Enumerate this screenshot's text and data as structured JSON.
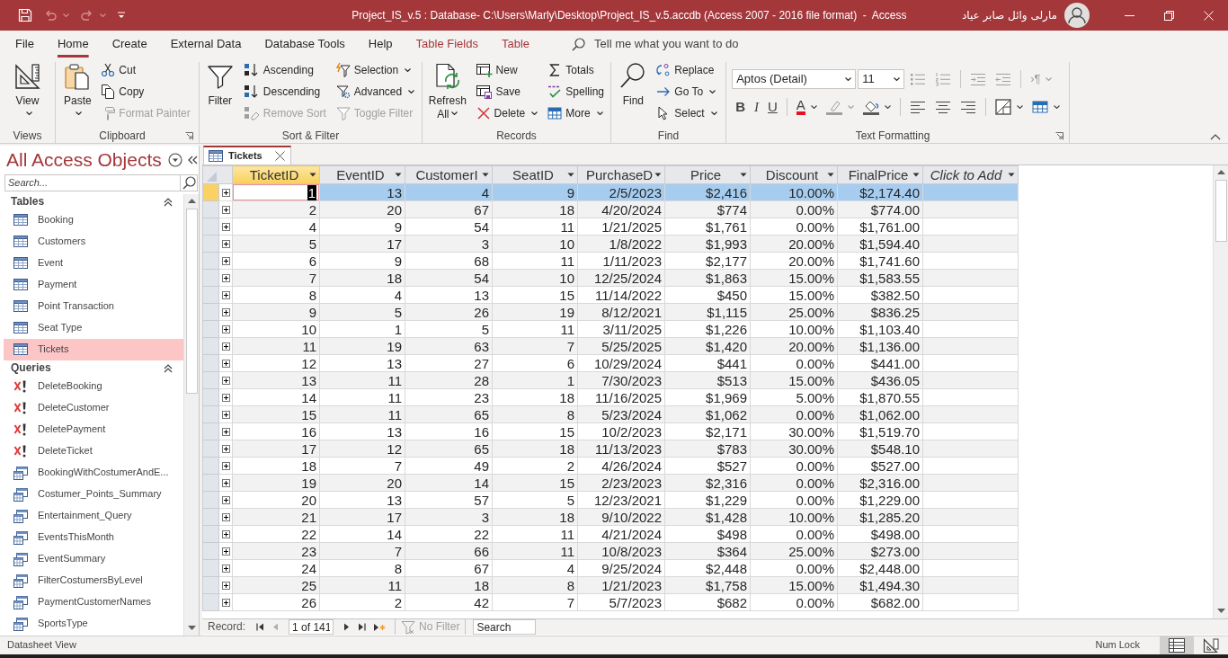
{
  "title_bar": {
    "quick_access": [
      {
        "disabled": false,
        "dropdown": false
      },
      {
        "disabled": true,
        "dropdown": true
      },
      {
        "disabled": true,
        "dropdown": true
      },
      {
        "disabled": false,
        "dropdown": false
      }
    ],
    "title": "Project_IS_v.5 : Database- C:\\Users\\Marly\\Desktop\\Project_IS_v.5.accdb (Access 2007 - 2016 file format)  -  Access",
    "user": "مارلی وائل صابر عیاد"
  },
  "ribbon_tabs": [
    {
      "label": "File",
      "selected": false,
      "kind": "standard"
    },
    {
      "label": "Home",
      "selected": true,
      "kind": "standard"
    },
    {
      "label": "Create",
      "selected": false,
      "kind": "standard"
    },
    {
      "label": "External Data",
      "selected": false,
      "kind": "standard"
    },
    {
      "label": "Database Tools",
      "selected": false,
      "kind": "standard"
    },
    {
      "label": "Help",
      "selected": false,
      "kind": "standard"
    },
    {
      "label": "Table Fields",
      "selected": false,
      "kind": "contextual"
    },
    {
      "label": "Table",
      "selected": false,
      "kind": "contextual"
    }
  ],
  "tell_me": {
    "placeholder": "Tell me what you want to do"
  },
  "ribbon_groups": [
    {
      "label": "Views",
      "kind": "buttons",
      "launcher": false,
      "controls": [
        {
          "kind": "large",
          "label": "View",
          "dropdown": true,
          "disabled": false
        }
      ]
    },
    {
      "label": "Clipboard",
      "kind": "buttons",
      "launcher": true,
      "controls": [
        {
          "kind": "large",
          "label": "Paste",
          "dropdown": true,
          "disabled": false
        },
        {
          "kind": "small",
          "label": "Cut",
          "dropdown": false,
          "disabled": false
        },
        {
          "kind": "small",
          "label": "Copy",
          "dropdown": false,
          "disabled": false
        },
        {
          "kind": "small",
          "label": "Format Painter",
          "dropdown": false,
          "disabled": true
        }
      ]
    },
    {
      "label": "Sort & Filter",
      "kind": "buttons",
      "launcher": false,
      "controls": [
        {
          "kind": "large",
          "label": "Filter",
          "dropdown": false,
          "disabled": false
        },
        {
          "kind": "small",
          "label": "Ascending",
          "dropdown": false,
          "disabled": false
        },
        {
          "kind": "small",
          "label": "Descending",
          "dropdown": false,
          "disabled": false
        },
        {
          "kind": "small",
          "label": "Remove Sort",
          "dropdown": false,
          "disabled": true
        },
        {
          "kind": "small",
          "label": "Selection",
          "dropdown": true,
          "disabled": false
        },
        {
          "kind": "small",
          "label": "Advanced",
          "dropdown": true,
          "disabled": false
        },
        {
          "kind": "small",
          "label": "Toggle Filter",
          "dropdown": false,
          "disabled": true
        }
      ]
    },
    {
      "label": "Records",
      "kind": "buttons",
      "launcher": false,
      "controls": [
        {
          "kind": "large",
          "label": "Refresh All",
          "dropdown": true,
          "disabled": false
        },
        {
          "kind": "small",
          "label": "New",
          "dropdown": false,
          "disabled": false
        },
        {
          "kind": "small",
          "label": "Save",
          "dropdown": false,
          "disabled": false
        },
        {
          "kind": "small",
          "label": "Delete",
          "dropdown": true,
          "disabled": false
        },
        {
          "kind": "small",
          "label": "Totals",
          "dropdown": false,
          "disabled": false
        },
        {
          "kind": "small",
          "label": "Spelling",
          "dropdown": false,
          "disabled": false
        },
        {
          "kind": "small",
          "label": "More",
          "dropdown": true,
          "disabled": false
        }
      ]
    },
    {
      "label": "Find",
      "kind": "buttons",
      "launcher": false,
      "controls": [
        {
          "kind": "large",
          "label": "Find",
          "dropdown": false,
          "disabled": false
        },
        {
          "kind": "small",
          "label": "Replace",
          "dropdown": false,
          "disabled": false
        },
        {
          "kind": "small",
          "label": "Go To",
          "dropdown": true,
          "disabled": false
        },
        {
          "kind": "small",
          "label": "Select",
          "dropdown": true,
          "disabled": false
        }
      ]
    },
    {
      "label": "Text Formatting",
      "kind": "format",
      "launcher": true,
      "lines": [
        {
          "items": [
            {
              "kind": "combo",
              "value": "Aptos (Detail)"
            },
            {
              "kind": "combo",
              "value": "11"
            },
            {
              "kind": "icon",
              "disabled": true,
              "dropdown": false
            },
            {
              "kind": "icon",
              "disabled": true,
              "dropdown": false
            },
            {
              "kind": "separator"
            },
            {
              "kind": "icon",
              "disabled": true,
              "dropdown": false
            },
            {
              "kind": "icon",
              "disabled": true,
              "dropdown": false
            },
            {
              "kind": "separator"
            },
            {
              "kind": "text",
              "label": "›¶",
              "disabled": true,
              "dropdown": true
            }
          ]
        },
        {
          "items": [
            {
              "kind": "bold",
              "label": "B",
              "disabled": false,
              "dropdown": false
            },
            {
              "kind": "italic",
              "label": "I",
              "disabled": false,
              "dropdown": false
            },
            {
              "kind": "underline",
              "label": "U",
              "disabled": false,
              "dropdown": false
            },
            {
              "kind": "separator"
            },
            {
              "kind": "font_color",
              "label": "A",
              "disabled": false,
              "dropdown": true
            },
            {
              "kind": "icon",
              "disabled": true,
              "dropdown": true
            },
            {
              "kind": "icon",
              "disabled": false,
              "dropdown": true
            },
            {
              "kind": "separator"
            },
            {
              "kind": "icon",
              "disabled": false,
              "dropdown": false
            },
            {
              "kind": "icon",
              "disabled": false,
              "dropdown": false
            },
            {
              "kind": "icon",
              "disabled": false,
              "dropdown": false
            },
            {
              "kind": "separator"
            },
            {
              "kind": "icon",
              "disabled": false,
              "dropdown": true
            },
            {
              "kind": "icon",
              "disabled": false,
              "dropdown": true
            }
          ]
        }
      ]
    }
  ],
  "nav_pane": {
    "title": "All Access Objects",
    "search": {
      "placeholder": "Search..."
    },
    "sections": [
      {
        "label": "Tables",
        "expanded": true,
        "items": [
          {
            "label": "Booking",
            "kind": "table",
            "selected": false
          },
          {
            "label": "Customers",
            "kind": "table",
            "selected": false
          },
          {
            "label": "Event",
            "kind": "table",
            "selected": false
          },
          {
            "label": "Payment",
            "kind": "table",
            "selected": false
          },
          {
            "label": "Point Transaction",
            "kind": "table",
            "selected": false
          },
          {
            "label": "Seat Type",
            "kind": "table",
            "selected": false
          },
          {
            "label": "Tickets",
            "kind": "table",
            "selected": true
          }
        ]
      },
      {
        "label": "Queries",
        "expanded": true,
        "items": [
          {
            "label": "DeleteBooking",
            "kind": "delete_query",
            "selected": false
          },
          {
            "label": "DeleteCustomer",
            "kind": "delete_query",
            "selected": false
          },
          {
            "label": "DeletePayment",
            "kind": "delete_query",
            "selected": false
          },
          {
            "label": "DeleteTicket",
            "kind": "delete_query",
            "selected": false
          },
          {
            "label": "BookingWithCostumerAndE...",
            "kind": "select_query",
            "selected": false
          },
          {
            "label": "Costumer_Points_Summary",
            "kind": "select_query",
            "selected": false
          },
          {
            "label": "Entertainment_Query",
            "kind": "select_query",
            "selected": false
          },
          {
            "label": "EventsThisMonth",
            "kind": "select_query",
            "selected": false
          },
          {
            "label": "EventSummary",
            "kind": "select_query",
            "selected": false
          },
          {
            "label": "FilterCostumersByLevel",
            "kind": "select_query",
            "selected": false
          },
          {
            "label": "PaymentCustomerNames",
            "kind": "select_query",
            "selected": false
          },
          {
            "label": "SportsType",
            "kind": "select_query",
            "selected": false
          }
        ]
      }
    ]
  },
  "document_tabs": [
    {
      "label": "Tickets",
      "selected": true
    }
  ],
  "datasheet": {
    "columns": [
      {
        "label": "TicketID",
        "kind": "field",
        "selected": true
      },
      {
        "label": "EventID",
        "kind": "field",
        "selected": false
      },
      {
        "label": "CustomerI",
        "kind": "field",
        "selected": false
      },
      {
        "label": "SeatID",
        "kind": "field",
        "selected": false
      },
      {
        "label": "PurchaseD",
        "kind": "field",
        "selected": false
      },
      {
        "label": "Price",
        "kind": "field",
        "selected": false
      },
      {
        "label": "Discount",
        "kind": "field",
        "selected": false
      },
      {
        "label": "FinalPrice",
        "kind": "field",
        "selected": false
      },
      {
        "label": "Click to Add",
        "kind": "add",
        "selected": false
      }
    ],
    "rows": [
      {
        "selected": true,
        "cells": [
          "1",
          "13",
          "4",
          "9",
          "2/5/2023",
          "$2,416",
          "10.00%",
          "$2,174.40"
        ]
      },
      {
        "selected": false,
        "cells": [
          "2",
          "20",
          "67",
          "18",
          "4/20/2024",
          "$774",
          "0.00%",
          "$774.00"
        ]
      },
      {
        "selected": false,
        "cells": [
          "4",
          "9",
          "54",
          "11",
          "1/21/2025",
          "$1,761",
          "0.00%",
          "$1,761.00"
        ]
      },
      {
        "selected": false,
        "cells": [
          "5",
          "17",
          "3",
          "10",
          "1/8/2022",
          "$1,993",
          "20.00%",
          "$1,594.40"
        ]
      },
      {
        "selected": false,
        "cells": [
          "6",
          "9",
          "68",
          "11",
          "1/11/2023",
          "$2,177",
          "20.00%",
          "$1,741.60"
        ]
      },
      {
        "selected": false,
        "cells": [
          "7",
          "18",
          "54",
          "10",
          "12/25/2024",
          "$1,863",
          "15.00%",
          "$1,583.55"
        ]
      },
      {
        "selected": false,
        "cells": [
          "8",
          "4",
          "13",
          "15",
          "11/14/2022",
          "$450",
          "15.00%",
          "$382.50"
        ]
      },
      {
        "selected": false,
        "cells": [
          "9",
          "5",
          "26",
          "19",
          "8/12/2021",
          "$1,115",
          "25.00%",
          "$836.25"
        ]
      },
      {
        "selected": false,
        "cells": [
          "10",
          "1",
          "5",
          "11",
          "3/11/2025",
          "$1,226",
          "10.00%",
          "$1,103.40"
        ]
      },
      {
        "selected": false,
        "cells": [
          "11",
          "19",
          "63",
          "7",
          "5/25/2025",
          "$1,420",
          "20.00%",
          "$1,136.00"
        ]
      },
      {
        "selected": false,
        "cells": [
          "12",
          "13",
          "27",
          "6",
          "10/29/2024",
          "$441",
          "0.00%",
          "$441.00"
        ]
      },
      {
        "selected": false,
        "cells": [
          "13",
          "11",
          "28",
          "1",
          "7/30/2023",
          "$513",
          "15.00%",
          "$436.05"
        ]
      },
      {
        "selected": false,
        "cells": [
          "14",
          "11",
          "23",
          "18",
          "11/16/2025",
          "$1,969",
          "5.00%",
          "$1,870.55"
        ]
      },
      {
        "selected": false,
        "cells": [
          "15",
          "11",
          "65",
          "8",
          "5/23/2024",
          "$1,062",
          "0.00%",
          "$1,062.00"
        ]
      },
      {
        "selected": false,
        "cells": [
          "16",
          "13",
          "16",
          "15",
          "10/2/2023",
          "$2,171",
          "30.00%",
          "$1,519.70"
        ]
      },
      {
        "selected": false,
        "cells": [
          "17",
          "12",
          "65",
          "18",
          "11/13/2023",
          "$783",
          "30.00%",
          "$548.10"
        ]
      },
      {
        "selected": false,
        "cells": [
          "18",
          "7",
          "49",
          "2",
          "4/26/2024",
          "$527",
          "0.00%",
          "$527.00"
        ]
      },
      {
        "selected": false,
        "cells": [
          "19",
          "20",
          "14",
          "15",
          "2/23/2023",
          "$2,316",
          "0.00%",
          "$2,316.00"
        ]
      },
      {
        "selected": false,
        "cells": [
          "20",
          "13",
          "57",
          "5",
          "12/23/2021",
          "$1,229",
          "0.00%",
          "$1,229.00"
        ]
      },
      {
        "selected": false,
        "cells": [
          "21",
          "17",
          "3",
          "18",
          "9/10/2022",
          "$1,428",
          "10.00%",
          "$1,285.20"
        ]
      },
      {
        "selected": false,
        "cells": [
          "22",
          "14",
          "22",
          "11",
          "4/21/2024",
          "$498",
          "0.00%",
          "$498.00"
        ]
      },
      {
        "selected": false,
        "cells": [
          "23",
          "7",
          "66",
          "11",
          "10/8/2023",
          "$364",
          "25.00%",
          "$273.00"
        ]
      },
      {
        "selected": false,
        "cells": [
          "24",
          "8",
          "67",
          "4",
          "9/25/2024",
          "$2,448",
          "0.00%",
          "$2,448.00"
        ]
      },
      {
        "selected": false,
        "cells": [
          "25",
          "11",
          "18",
          "8",
          "1/21/2023",
          "$1,758",
          "15.00%",
          "$1,494.30"
        ]
      },
      {
        "selected": false,
        "cells": [
          "26",
          "2",
          "42",
          "7",
          "5/7/2023",
          "$682",
          "0.00%",
          "$682.00"
        ]
      }
    ]
  },
  "record_nav": {
    "label": "Record:",
    "buttons": [
      {
        "disabled": false
      },
      {
        "disabled": true
      },
      {
        "disabled": false
      },
      {
        "disabled": false
      },
      {
        "disabled": false
      }
    ],
    "position": "1 of 141",
    "filter": {
      "label": "No Filter",
      "disabled": true
    },
    "search": {
      "value": "Search"
    }
  },
  "status_bar": {
    "text": "Datasheet View",
    "indicators": [
      "Num Lock"
    ],
    "views": [
      {
        "selected": true
      },
      {
        "selected": false
      }
    ]
  }
}
